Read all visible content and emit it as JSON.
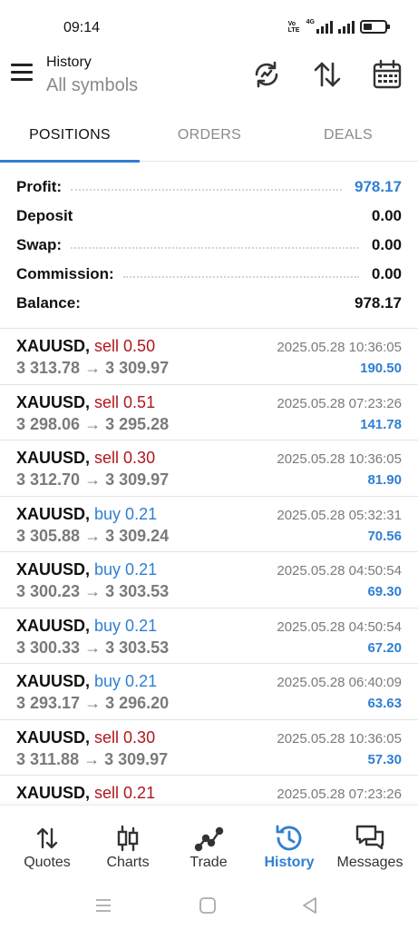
{
  "status_bar": {
    "time": "09:14",
    "volte": "Vo LTE",
    "network": "4G"
  },
  "header": {
    "title": "History",
    "subtitle": "All symbols"
  },
  "tabs": [
    {
      "label": "POSITIONS",
      "active": true
    },
    {
      "label": "ORDERS",
      "active": false
    },
    {
      "label": "DEALS",
      "active": false
    }
  ],
  "summary": [
    {
      "label": "Profit:",
      "value": "978.17",
      "dots": true,
      "blue": true
    },
    {
      "label": "Deposit",
      "value": "0.00",
      "dots": false,
      "blue": false
    },
    {
      "label": "Swap:",
      "value": "0.00",
      "dots": true,
      "blue": false
    },
    {
      "label": "Commission:",
      "value": "0.00",
      "dots": true,
      "blue": false
    },
    {
      "label": "Balance:",
      "value": "978.17",
      "dots": false,
      "blue": false
    }
  ],
  "deals": [
    {
      "symbol": "XAUUSD,",
      "side": "sell 0.50",
      "type": "sell",
      "prices": "3 313.78 → 3 309.97",
      "time": "2025.05.28 10:36:05",
      "profit": "190.50"
    },
    {
      "symbol": "XAUUSD,",
      "side": "sell 0.51",
      "type": "sell",
      "prices": "3 298.06 → 3 295.28",
      "time": "2025.05.28 07:23:26",
      "profit": "141.78"
    },
    {
      "symbol": "XAUUSD,",
      "side": "sell 0.30",
      "type": "sell",
      "prices": "3 312.70 → 3 309.97",
      "time": "2025.05.28 10:36:05",
      "profit": "81.90"
    },
    {
      "symbol": "XAUUSD,",
      "side": "buy 0.21",
      "type": "buy",
      "prices": "3 305.88 → 3 309.24",
      "time": "2025.05.28 05:32:31",
      "profit": "70.56"
    },
    {
      "symbol": "XAUUSD,",
      "side": "buy 0.21",
      "type": "buy",
      "prices": "3 300.23 → 3 303.53",
      "time": "2025.05.28 04:50:54",
      "profit": "69.30"
    },
    {
      "symbol": "XAUUSD,",
      "side": "buy 0.21",
      "type": "buy",
      "prices": "3 300.33 → 3 303.53",
      "time": "2025.05.28 04:50:54",
      "profit": "67.20"
    },
    {
      "symbol": "XAUUSD,",
      "side": "buy 0.21",
      "type": "buy",
      "prices": "3 293.17 → 3 296.20",
      "time": "2025.05.28 06:40:09",
      "profit": "63.63"
    },
    {
      "symbol": "XAUUSD,",
      "side": "sell 0.30",
      "type": "sell",
      "prices": "3 311.88 → 3 309.97",
      "time": "2025.05.28 10:36:05",
      "profit": "57.30"
    },
    {
      "symbol": "XAUUSD,",
      "side": "sell 0.21",
      "type": "sell",
      "prices": "",
      "time": "2025.05.28 07:23:26",
      "profit": ""
    }
  ],
  "bottom_nav": [
    {
      "label": "Quotes",
      "icon": "quotes-icon",
      "active": false
    },
    {
      "label": "Charts",
      "icon": "charts-icon",
      "active": false
    },
    {
      "label": "Trade",
      "icon": "trade-icon",
      "active": false
    },
    {
      "label": "History",
      "icon": "history-icon",
      "active": true
    },
    {
      "label": "Messages",
      "icon": "messages-icon",
      "active": false
    }
  ],
  "colors": {
    "accent": "#2f7fd3",
    "sell": "#b0161d",
    "buy": "#2f7fd3",
    "muted": "#7a7a7a"
  }
}
